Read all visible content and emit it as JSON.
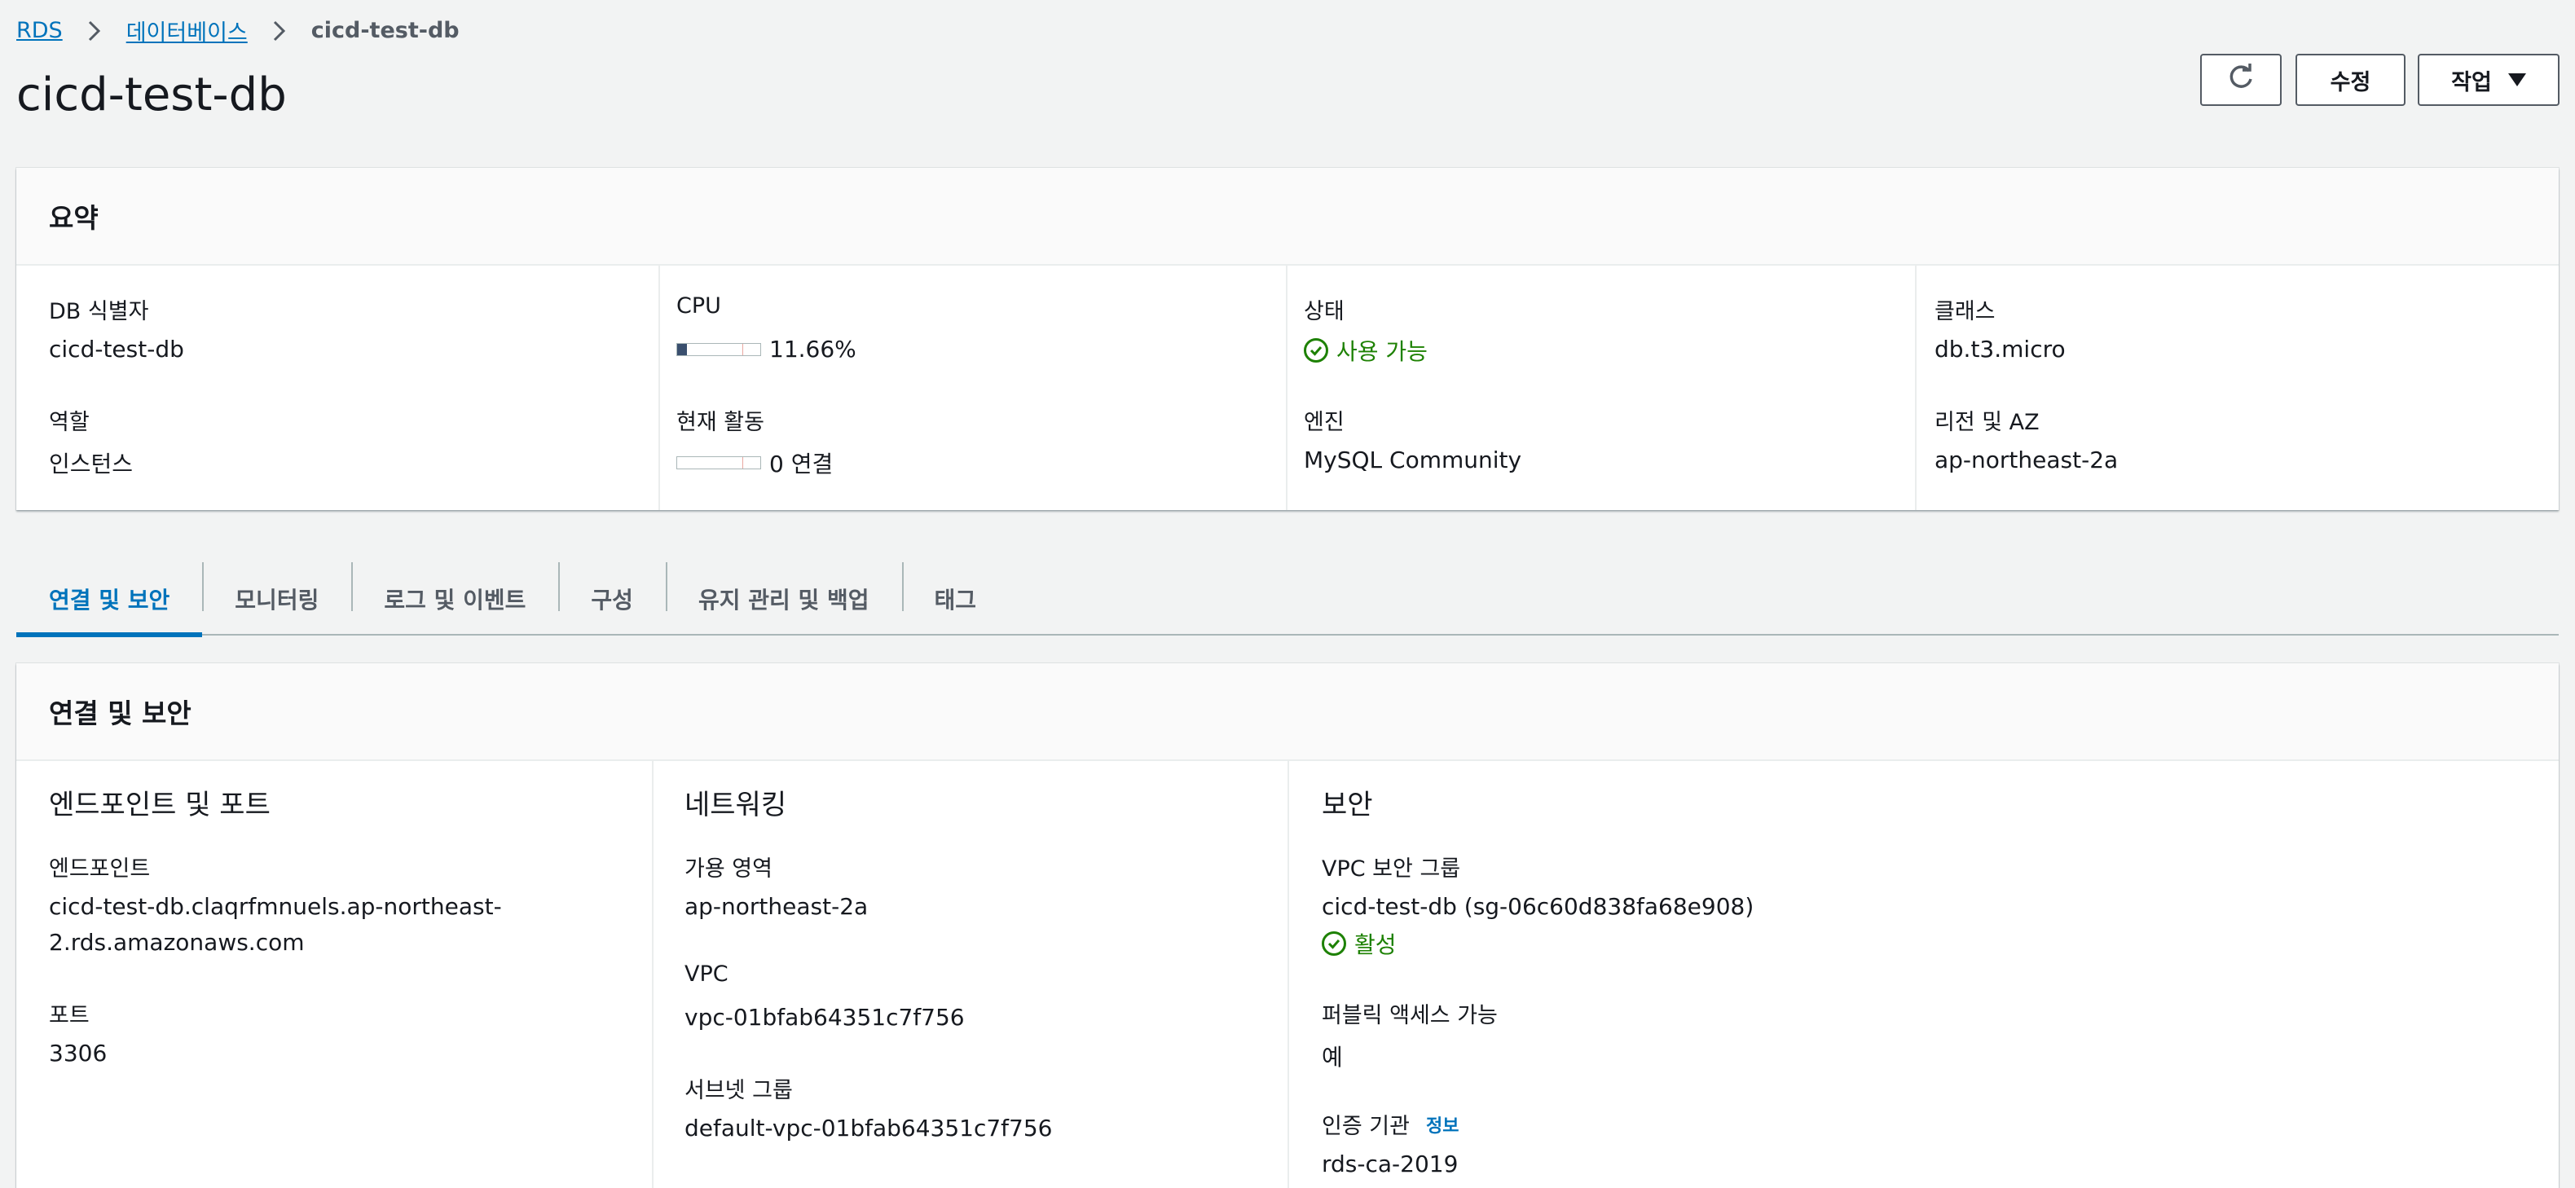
{
  "breadcrumb": {
    "rds": "RDS",
    "databases": "데이터베이스",
    "current": "cicd-test-db"
  },
  "page_title": "cicd-test-db",
  "header_buttons": {
    "refresh_icon": "refresh-icon",
    "modify": "수정",
    "actions": "작업"
  },
  "summary": {
    "title": "요약",
    "db_identifier_label": "DB 식별자",
    "db_identifier": "cicd-test-db",
    "role_label": "역할",
    "role": "인스턴스",
    "cpu_label": "CPU",
    "cpu_value": "11.66%",
    "cpu_fraction": 0.1166,
    "activity_label": "현재 활동",
    "activity_value": "0 연결",
    "activity_fraction": 0,
    "status_label": "상태",
    "status": "사용 가능",
    "engine_label": "엔진",
    "engine": "MySQL Community",
    "class_label": "클래스",
    "class": "db.t3.micro",
    "region_label": "리전 및 AZ",
    "region": "ap-northeast-2a"
  },
  "tabs": [
    {
      "label": "연결 및 보안",
      "active": true
    },
    {
      "label": "모니터링"
    },
    {
      "label": "로그 및 이벤트"
    },
    {
      "label": "구성"
    },
    {
      "label": "유지 관리 및 백업"
    },
    {
      "label": "태그"
    }
  ],
  "connectivity": {
    "title": "연결 및 보안",
    "endpoint_section": {
      "title": "엔드포인트 및 포트",
      "endpoint_label": "엔드포인트",
      "endpoint_line1": "cicd-test-db.claqrfmnuels.ap-northeast-",
      "endpoint_line2": "2.rds.amazonaws.com",
      "port_label": "포트",
      "port": "3306"
    },
    "networking": {
      "title": "네트워킹",
      "az_label": "가용 영역",
      "az": "ap-northeast-2a",
      "vpc_label": "VPC",
      "vpc": "vpc-01bfab64351c7f756",
      "subnet_label": "서브넷 그룹",
      "subnet": "default-vpc-01bfab64351c7f756"
    },
    "security": {
      "title": "보안",
      "sg_label": "VPC 보안 그룹",
      "sg": "cicd-test-db (sg-06c60d838fa68e908)",
      "sg_status": "활성",
      "public_label": "퍼블릭 액세스 가능",
      "public": "예",
      "ca_label": "인증 기관",
      "ca_info": "정보",
      "ca": "rds-ca-2019"
    }
  },
  "colors": {
    "link": "#0073bb",
    "success": "#1d8102",
    "text": "#16191f",
    "background": "#f2f3f3"
  }
}
